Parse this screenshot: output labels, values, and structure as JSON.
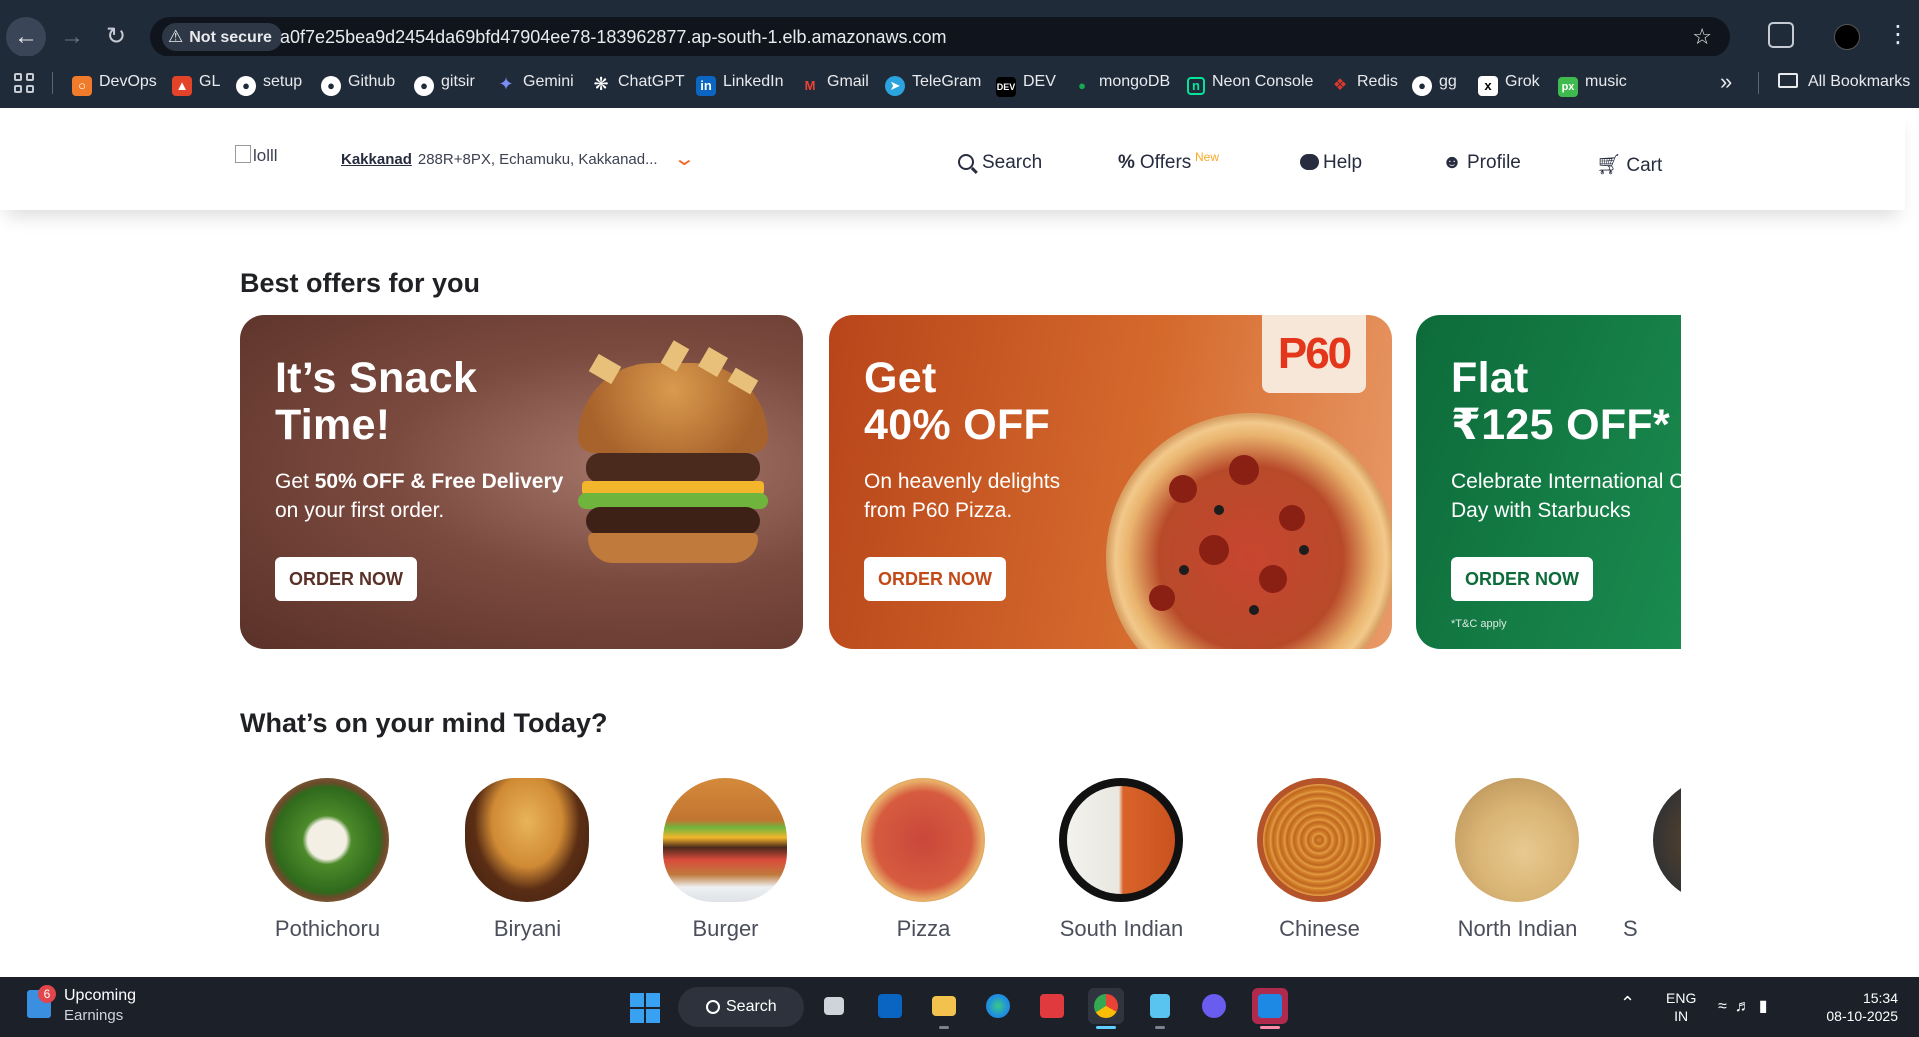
{
  "browser": {
    "security_label": "Not secure",
    "url": "a0f7e25bea9d2454da69bfd47904ee78-183962877.ap-south-1.elb.amazonaws.com",
    "bookmarks": [
      {
        "label": "DevOps",
        "color": "#f07b2a"
      },
      {
        "label": "GL",
        "color": "#e24329"
      },
      {
        "label": "setup",
        "color": "#ffffff"
      },
      {
        "label": "Github",
        "color": "#ffffff"
      },
      {
        "label": "gitsir",
        "color": "#ffffff"
      },
      {
        "label": "Gemini",
        "color": "#7b8cf5"
      },
      {
        "label": "ChatGPT",
        "color": "#ffffff"
      },
      {
        "label": "LinkedIn",
        "color": "#0a66c2"
      },
      {
        "label": "Gmail",
        "color": "#ea4335"
      },
      {
        "label": "TeleGram",
        "color": "#2aa3df"
      },
      {
        "label": "DEV",
        "color": "#000000"
      },
      {
        "label": "mongoDB",
        "color": "#13aa52"
      },
      {
        "label": "Neon Console",
        "color": "#00e599"
      },
      {
        "label": "Redis",
        "color": "#dc382d"
      },
      {
        "label": "gg",
        "color": "#ffffff"
      },
      {
        "label": "Grok",
        "color": "#ffffff"
      },
      {
        "label": "music",
        "color": "#3fba4f"
      }
    ],
    "all_bookmarks": "All Bookmarks"
  },
  "header": {
    "logo_alt": "lolll",
    "location_city": "Kakkanad",
    "location_address": "288R+8PX, Echamuku, Kakkanad...",
    "nav": {
      "search": "Search",
      "offers": "Offers",
      "offers_badge": "New",
      "help": "Help",
      "profile": "Profile",
      "cart": "Cart"
    }
  },
  "offers_section": {
    "title": "Best offers for you",
    "cards": [
      {
        "heading_line1": "It’s Snack",
        "heading_line2": "Time!",
        "sub_pre": "Get ",
        "sub_bold": "50% OFF & Free Delivery",
        "sub_post": " on your first order.",
        "button": "ORDER NOW"
      },
      {
        "heading_line1": "Get",
        "heading_line2": "40% OFF",
        "sub": "On heavenly delights from P60 Pizza.",
        "badge": "P60",
        "button": "ORDER NOW"
      },
      {
        "heading_line1": "Flat",
        "heading_line2": "₹125 OFF*",
        "sub": "Celebrate International Coffee Day with Starbucks",
        "button": "ORDER NOW",
        "terms": "*T&C apply"
      }
    ]
  },
  "categories_section": {
    "title": "What’s on your mind Today?",
    "items": [
      {
        "label": "Pothichoru"
      },
      {
        "label": "Biryani"
      },
      {
        "label": "Burger"
      },
      {
        "label": "Pizza"
      },
      {
        "label": "South Indian"
      },
      {
        "label": "Chinese"
      },
      {
        "label": "North Indian"
      },
      {
        "label": "S"
      }
    ]
  },
  "taskbar": {
    "widget_badge": "6",
    "widget_title": "Upcoming",
    "widget_sub": "Earnings",
    "search_label": "Search",
    "lang_line1": "ENG",
    "lang_line2": "IN",
    "time": "15:34",
    "date": "08-10-2025"
  }
}
